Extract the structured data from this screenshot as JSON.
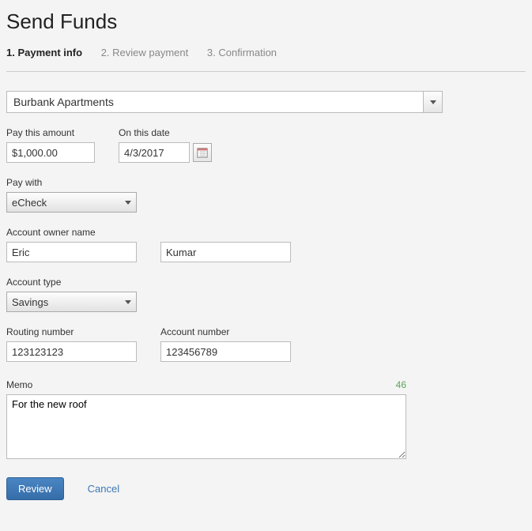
{
  "title": "Send Funds",
  "steps": {
    "s1": "1. Payment info",
    "s2": "2. Review payment",
    "s3": "3. Confirmation"
  },
  "recipient": {
    "value": "Burbank Apartments"
  },
  "amount": {
    "label": "Pay this amount",
    "value": "$1,000.00"
  },
  "date": {
    "label": "On this date",
    "value": "4/3/2017"
  },
  "payWith": {
    "label": "Pay with",
    "value": "eCheck"
  },
  "owner": {
    "label": "Account owner name",
    "first": "Eric",
    "last": "Kumar"
  },
  "accountType": {
    "label": "Account type",
    "value": "Savings"
  },
  "routing": {
    "label": "Routing number",
    "value": "123123123"
  },
  "account": {
    "label": "Account number",
    "value": "123456789"
  },
  "memo": {
    "label": "Memo",
    "value": "For the new roof",
    "remaining": "46"
  },
  "actions": {
    "review": "Review",
    "cancel": "Cancel"
  }
}
